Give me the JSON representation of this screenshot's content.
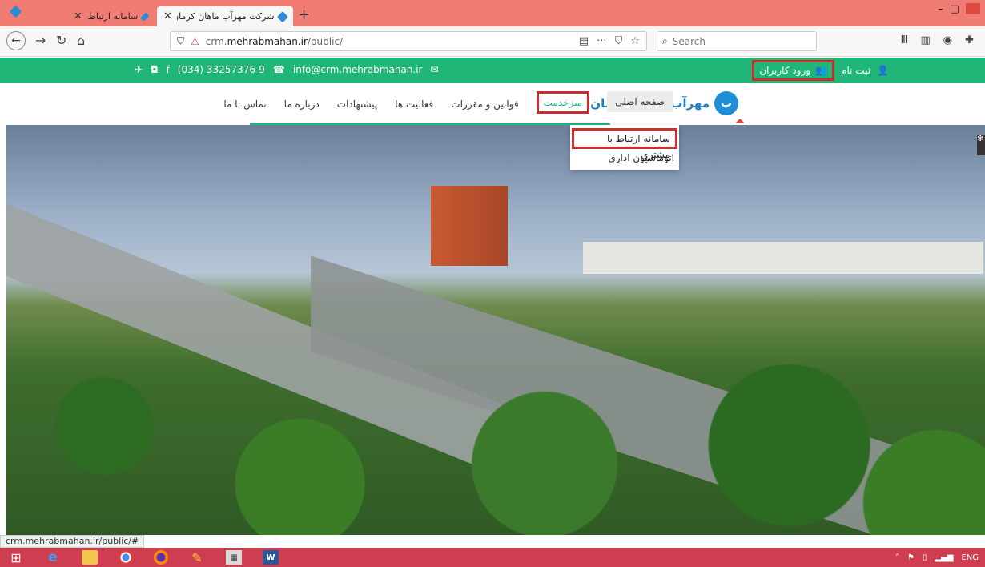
{
  "browser": {
    "tabs": [
      {
        "label": "سامانه ارتباط با مشتری",
        "active": false
      },
      {
        "label": "شرکت مهرآب ماهان کرمان",
        "active": true
      }
    ],
    "new_tab": "+",
    "url_host": "crm.",
    "url_domain": "mehrabmahan.ir",
    "url_path": "/public/",
    "search_placeholder": "Search",
    "status_url": "crm.mehrabmahan.ir/public/#"
  },
  "site": {
    "email": "info@crm.mehrabmahan.ir",
    "phone": "(034) 33257376-9",
    "login_label": "ورود کاربران",
    "register_label": "ثبت نام",
    "logo_text": "مهرآب ماهان کرمان",
    "menu": [
      {
        "key": "home",
        "label": "صفحه اصلی"
      },
      {
        "key": "service",
        "label": "میزخدمت"
      },
      {
        "key": "laws",
        "label": "قوانین و مقررات"
      },
      {
        "key": "activities",
        "label": "فعالیت ها"
      },
      {
        "key": "suggestions",
        "label": "پیشنهادات"
      },
      {
        "key": "about",
        "label": "درباره ما"
      },
      {
        "key": "contact",
        "label": "تماس با ما"
      }
    ],
    "dropdown": [
      {
        "label": "سامانه ارتباط با مشتری"
      },
      {
        "label": "اتوماسیون اداری"
      }
    ]
  },
  "taskbar": {
    "lang": "ENG"
  },
  "colors": {
    "green": "#22b578",
    "highlight_red": "#c8302e",
    "blue": "#1c7fc4",
    "tab_strip": "#f07c73",
    "taskbar": "#cf3d50"
  }
}
